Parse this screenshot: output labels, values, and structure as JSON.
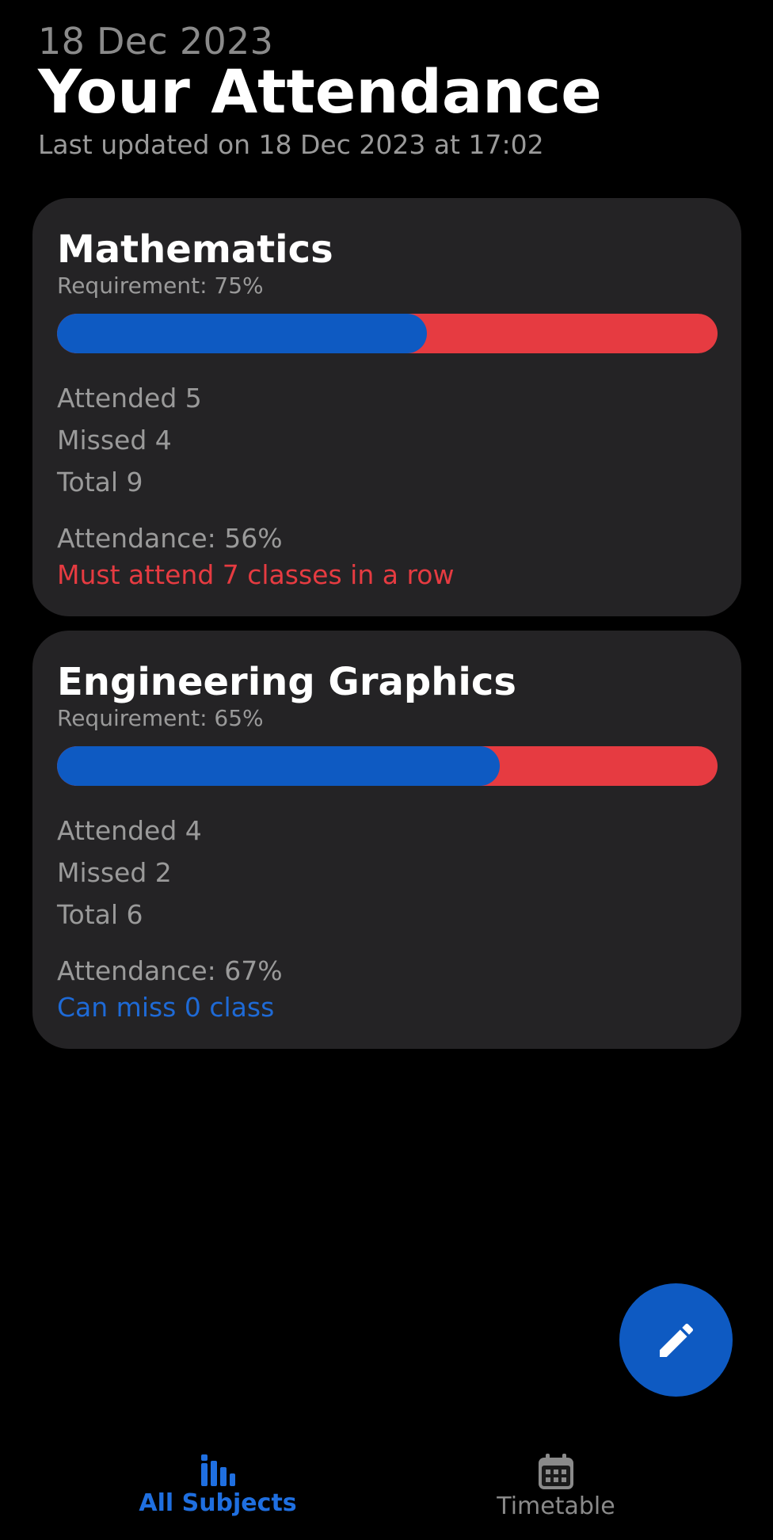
{
  "header": {
    "date": "18 Dec 2023",
    "title": "Your Attendance",
    "last_updated": "Last updated on 18 Dec 2023 at 17:02"
  },
  "subjects": [
    {
      "name": "Mathematics",
      "requirement": "Requirement: 75%",
      "attended_fraction": 0.56,
      "attended": "Attended 5",
      "missed": "Missed 4",
      "total": "Total 9",
      "attendance": "Attendance: 56%",
      "note": "Must attend 7 classes in a row",
      "note_status": "warning"
    },
    {
      "name": "Engineering Graphics",
      "requirement": "Requirement: 65%",
      "attended_fraction": 0.67,
      "attended": "Attended 4",
      "missed": "Missed 2",
      "total": "Total 6",
      "attendance": "Attendance: 67%",
      "note": "Can miss 0 class",
      "note_status": "ok"
    }
  ],
  "fab": {
    "icon": "pencil-icon"
  },
  "nav": {
    "items": [
      {
        "label": "All Subjects",
        "icon": "bar-chart-icon",
        "active": true
      },
      {
        "label": "Timetable",
        "icon": "calendar-icon",
        "active": false
      }
    ]
  },
  "colors": {
    "accent_blue": "#0e5ac2",
    "missed_red": "#e63b41",
    "card_bg": "#242325",
    "background": "#000000"
  }
}
